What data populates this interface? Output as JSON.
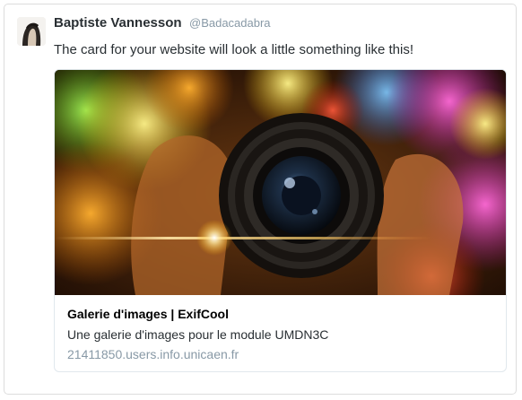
{
  "tweet": {
    "author_name": "Baptiste Vannesson",
    "author_handle": "@Badacadabra",
    "text": "The card for your website will look a little something like this!"
  },
  "card": {
    "image_icon": "camera-lens-photo",
    "title": "Galerie d'images | ExifCool",
    "description": "Une galerie d'images pour le module UMDN3C",
    "domain": "21411850.users.info.unicaen.fr"
  },
  "colors": {
    "name": "#292f33",
    "muted": "#8899a6",
    "border": "#e1e8ed"
  }
}
